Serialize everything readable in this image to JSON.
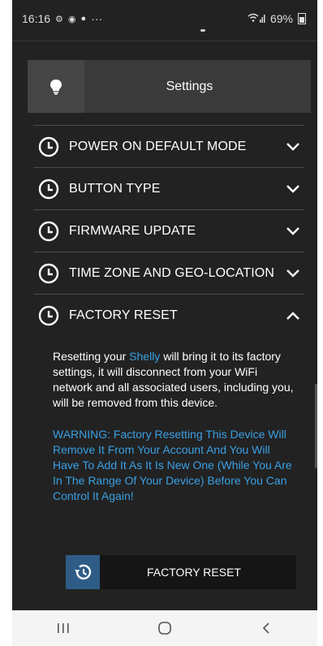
{
  "status_bar": {
    "time": "16:16",
    "more": "···",
    "battery": "69%"
  },
  "header": {
    "title": "Settings",
    "icon": "lightbulb-icon"
  },
  "sections": [
    {
      "label": "POWER ON DEFAULT MODE",
      "state": "collapsed"
    },
    {
      "label": "BUTTON TYPE",
      "state": "collapsed"
    },
    {
      "label": "FIRMWARE UPDATE",
      "state": "collapsed"
    },
    {
      "label": "TIME ZONE AND GEO-LOCATION",
      "state": "collapsed"
    },
    {
      "label": "FACTORY RESET",
      "state": "expanded"
    }
  ],
  "factory_reset": {
    "text_before": "Resetting your ",
    "brand": "Shelly",
    "text_after": " will bring it to its factory settings, it will disconnect from your WiFi network and all associated users, including you, will be removed from this device.",
    "warning": "WARNING: Factory Resetting This Device Will Remove It From Your Account And You Will Have To Add It As It Is New One (While You Are In The Range Of Your Device) Before You Can Control It Again!",
    "button_label": "FACTORY RESET"
  },
  "colors": {
    "background": "#222222",
    "accent": "#3aa0e4",
    "button_icon_bg": "#2e5c86"
  },
  "nav": [
    "recents-icon",
    "home-icon",
    "back-icon"
  ]
}
